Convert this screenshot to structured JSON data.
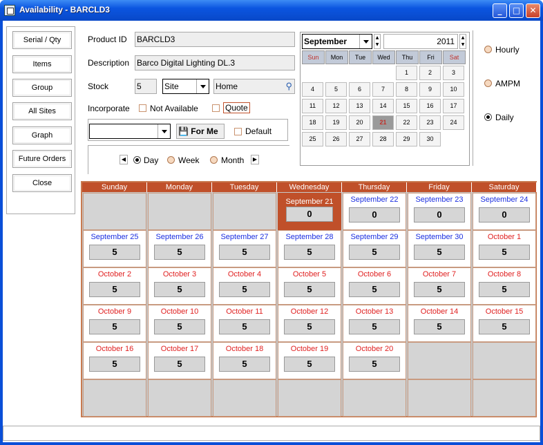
{
  "window": {
    "title": "Availability - BARCLD3"
  },
  "nav": [
    "Serial / Qty",
    "Items",
    "Group",
    "All Sites",
    "Graph",
    "Future Orders",
    "Close"
  ],
  "form": {
    "product_id_label": "Product ID",
    "product_id": "BARCLD3",
    "description_label": "Description",
    "description": "Barco Digital Lighting DL.3",
    "stock_label": "Stock",
    "stock_value": "5",
    "site_select": "Site",
    "location": "Home",
    "incorporate_label": "Incorporate",
    "not_available": "Not Available",
    "quote": "Quote",
    "for_me": "For Me",
    "default": "Default",
    "day": "Day",
    "week": "Week",
    "month": "Month"
  },
  "minical": {
    "month": "September",
    "year": "2011",
    "days": [
      "Sun",
      "Mon",
      "Tue",
      "Wed",
      "Thu",
      "Fri",
      "Sat"
    ],
    "dates": [
      [
        "",
        "",
        "",
        "",
        "1",
        "2",
        "3"
      ],
      [
        "4",
        "5",
        "6",
        "7",
        "8",
        "9",
        "10"
      ],
      [
        "11",
        "12",
        "13",
        "14",
        "15",
        "16",
        "17"
      ],
      [
        "18",
        "19",
        "20",
        "21",
        "22",
        "23",
        "24"
      ],
      [
        "25",
        "26",
        "27",
        "28",
        "29",
        "30",
        ""
      ]
    ],
    "today": "21"
  },
  "view": {
    "hourly": "Hourly",
    "ampm": "AMPM",
    "daily": "Daily",
    "selected": "daily"
  },
  "calendar": {
    "headers": [
      "Sunday",
      "Monday",
      "Tuesday",
      "Wednesday",
      "Thursday",
      "Friday",
      "Saturday"
    ],
    "weeks": [
      [
        null,
        null,
        null,
        {
          "d": "September 21",
          "v": "0",
          "c": "today"
        },
        {
          "d": "September 22",
          "v": "0",
          "c": "blue"
        },
        {
          "d": "September 23",
          "v": "0",
          "c": "blue"
        },
        {
          "d": "September 24",
          "v": "0",
          "c": "blue"
        }
      ],
      [
        {
          "d": "September 25",
          "v": "5",
          "c": "blue"
        },
        {
          "d": "September 26",
          "v": "5",
          "c": "blue"
        },
        {
          "d": "September 27",
          "v": "5",
          "c": "blue"
        },
        {
          "d": "September 28",
          "v": "5",
          "c": "blue"
        },
        {
          "d": "September 29",
          "v": "5",
          "c": "blue"
        },
        {
          "d": "September 30",
          "v": "5",
          "c": "blue"
        },
        {
          "d": "October 1",
          "v": "5",
          "c": "red"
        }
      ],
      [
        {
          "d": "October 2",
          "v": "5",
          "c": "red"
        },
        {
          "d": "October 3",
          "v": "5",
          "c": "red"
        },
        {
          "d": "October 4",
          "v": "5",
          "c": "red"
        },
        {
          "d": "October 5",
          "v": "5",
          "c": "red"
        },
        {
          "d": "October 6",
          "v": "5",
          "c": "red"
        },
        {
          "d": "October 7",
          "v": "5",
          "c": "red"
        },
        {
          "d": "October 8",
          "v": "5",
          "c": "red"
        }
      ],
      [
        {
          "d": "October 9",
          "v": "5",
          "c": "red"
        },
        {
          "d": "October 10",
          "v": "5",
          "c": "red"
        },
        {
          "d": "October 11",
          "v": "5",
          "c": "red"
        },
        {
          "d": "October 12",
          "v": "5",
          "c": "red"
        },
        {
          "d": "October 13",
          "v": "5",
          "c": "red"
        },
        {
          "d": "October 14",
          "v": "5",
          "c": "red"
        },
        {
          "d": "October 15",
          "v": "5",
          "c": "red"
        }
      ],
      [
        {
          "d": "October 16",
          "v": "5",
          "c": "red"
        },
        {
          "d": "October 17",
          "v": "5",
          "c": "red"
        },
        {
          "d": "October 18",
          "v": "5",
          "c": "red"
        },
        {
          "d": "October 19",
          "v": "5",
          "c": "red"
        },
        {
          "d": "October 20",
          "v": "5",
          "c": "red"
        },
        null,
        null
      ],
      [
        null,
        null,
        null,
        null,
        null,
        null,
        null
      ]
    ]
  },
  "colors": {
    "blue": "#1a2ee0",
    "red": "#e02020",
    "accent": "#c0502a"
  }
}
